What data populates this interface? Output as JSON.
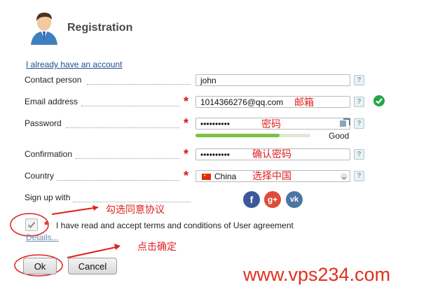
{
  "header": {
    "title": "Registration"
  },
  "links": {
    "have_account": "I already have an account",
    "details": "Details..."
  },
  "form": {
    "contact": {
      "label": "Contact person",
      "value": "john"
    },
    "email": {
      "label": "Email address",
      "value": "1014366276@qq.com",
      "note": "邮箱"
    },
    "password": {
      "label": "Password",
      "value": "••••••••••",
      "note": "密码",
      "strength_label": "Good",
      "strength": 0.73
    },
    "confirmation": {
      "label": "Confirmation",
      "value": "••••••••••",
      "note": "确认密码"
    },
    "country": {
      "label": "Country",
      "value": "China",
      "note": "选择中国"
    },
    "signup": {
      "label": "Sign up with",
      "facebook": "f",
      "google": "g+",
      "vk": "vk"
    },
    "agreement": {
      "text": "I have read and accept terms and conditions of User agreement",
      "note": "勾选同意协议"
    }
  },
  "buttons": {
    "ok": "Ok",
    "cancel": "Cancel",
    "note": "点击确定"
  },
  "watermark": "www.vps234.com",
  "colors": {
    "required": "#d91515",
    "annotation": "#e02020",
    "strength_bar": "#7bc144",
    "valid": "#22a64b"
  }
}
